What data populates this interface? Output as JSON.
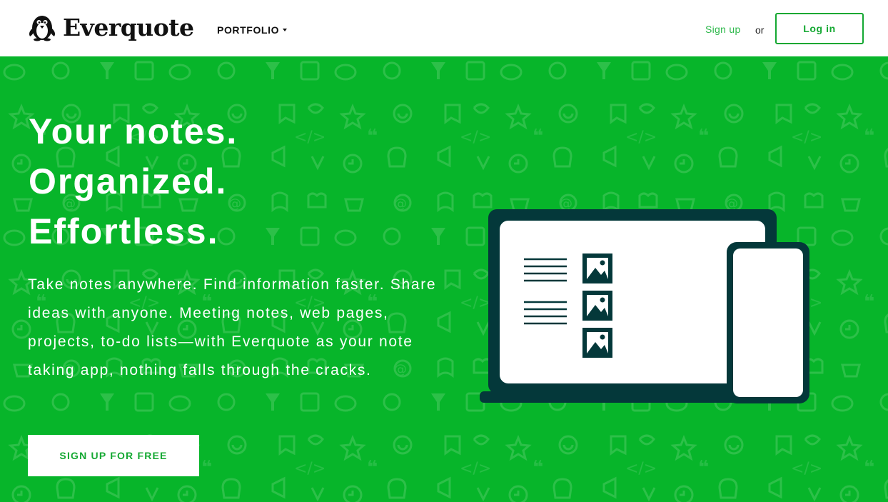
{
  "header": {
    "brand": "Everquote",
    "portfolio_label": "PORTFOLIO",
    "signup_label": "Sign up",
    "or_label": "or",
    "login_label": "Log in"
  },
  "hero": {
    "headline": [
      "Your notes.",
      "Organized.",
      "Effortless."
    ],
    "body": "Take notes anywhere. Find information faster. Share ideas with anyone. Meeting notes, web pages, projects, to-do lists—with Everquote as your note taking app, nothing falls through the cracks.",
    "cta_label": "SIGN UP FOR FREE"
  },
  "colors": {
    "brand_green": "#07b52a",
    "accent_green": "#14a832",
    "device_dark": "#04383a",
    "header_bg": "#ffffff"
  },
  "icons": [
    "penguin-logo-icon",
    "caret-down-icon",
    "laptop-illustration",
    "phone-illustration",
    "image-icon"
  ]
}
